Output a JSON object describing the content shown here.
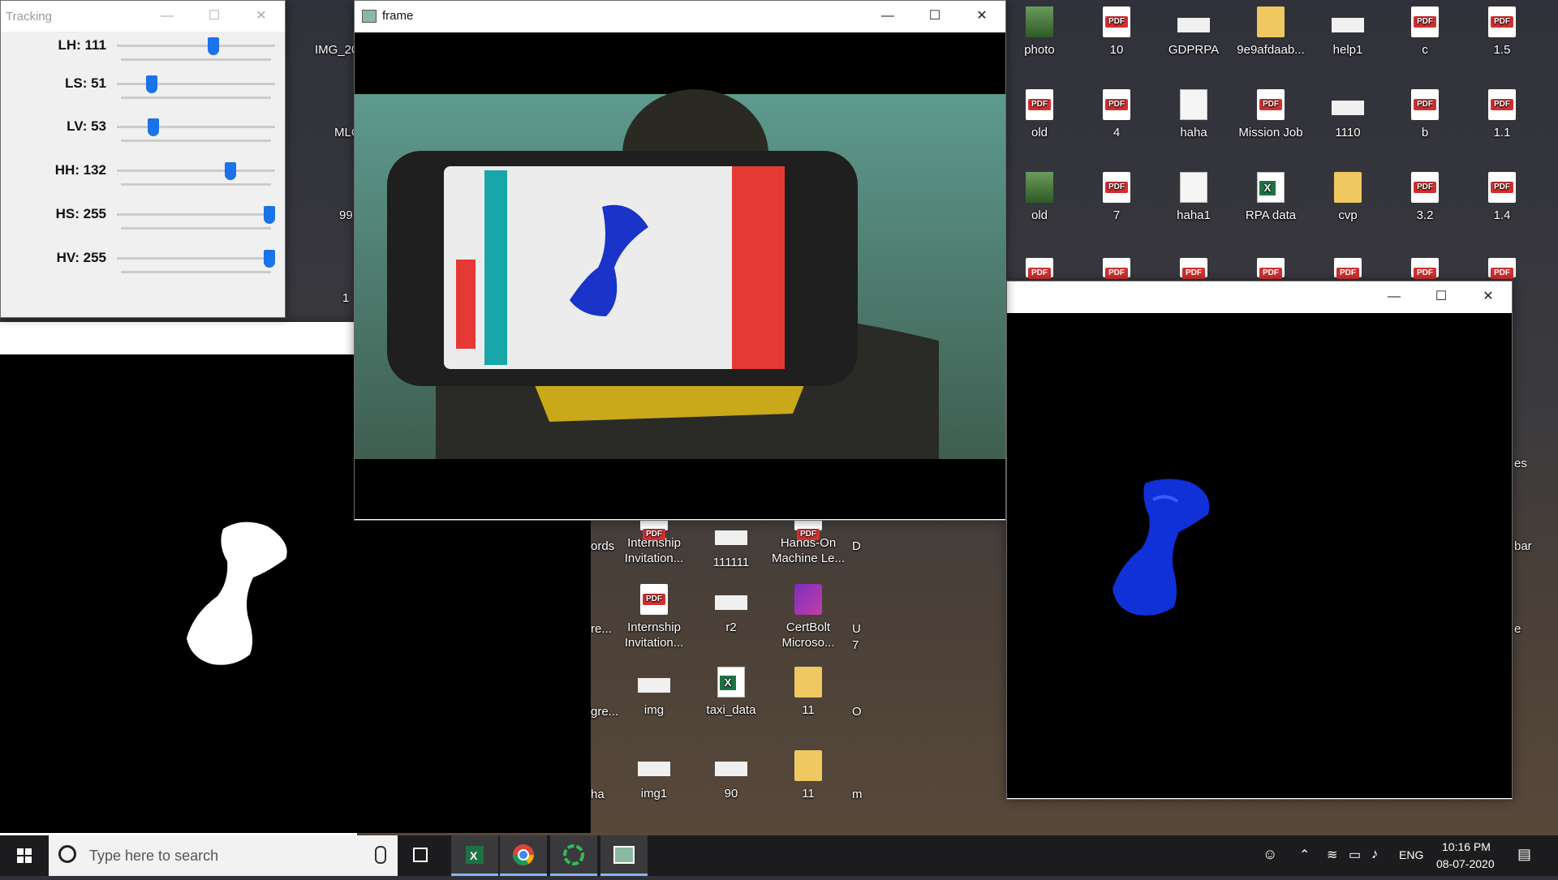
{
  "desktop": {
    "icons_right": [
      {
        "label": "photo",
        "type": "photo"
      },
      {
        "label": "10",
        "type": "pdf"
      },
      {
        "label": "GDPRPA",
        "type": "thumb"
      },
      {
        "label": "9e9afdaab...",
        "type": "folder"
      },
      {
        "label": "help1",
        "type": "thumb"
      },
      {
        "label": "c",
        "type": "pdf"
      },
      {
        "label": "1.5",
        "type": "pdf"
      },
      {
        "label": "old",
        "type": "pdf"
      },
      {
        "label": "4",
        "type": "pdf"
      },
      {
        "label": "haha",
        "type": "doc"
      },
      {
        "label": "Mission Job",
        "type": "pdf"
      },
      {
        "label": "1110",
        "type": "thumb"
      },
      {
        "label": "b",
        "type": "pdf"
      },
      {
        "label": "1.1",
        "type": "pdf"
      },
      {
        "label": "old",
        "type": "photo"
      },
      {
        "label": "7",
        "type": "pdf"
      },
      {
        "label": "haha1",
        "type": "doc"
      },
      {
        "label": "RPA data",
        "type": "xls"
      },
      {
        "label": "cvp",
        "type": "folder"
      },
      {
        "label": "3.2",
        "type": "pdf"
      },
      {
        "label": "1.4",
        "type": "pdf"
      }
    ],
    "icons_middle": [
      {
        "label": "Internship Invitation...",
        "type": "pdf"
      },
      {
        "label": "111111",
        "type": "thumb"
      },
      {
        "label": "Hands-On Machine Le...",
        "type": "pdf"
      },
      {
        "label": "Internship Invitation...",
        "type": "pdf"
      },
      {
        "label": "r2",
        "type": "thumb"
      },
      {
        "label": "CertBolt Microso...",
        "type": "app"
      },
      {
        "label": "img",
        "type": "thumb"
      },
      {
        "label": "taxi_data",
        "type": "xls"
      },
      {
        "label": "11",
        "type": "folder"
      },
      {
        "label": "img1",
        "type": "thumb"
      },
      {
        "label": "90",
        "type": "thumb"
      },
      {
        "label": "11",
        "type": "folder"
      }
    ],
    "partial_left": [
      "IMG_20",
      "MLC",
      "99",
      "1"
    ],
    "partial_mid_left": [
      "ords",
      "re...",
      "gre...",
      "ha"
    ],
    "partial_mid_right": [
      "D",
      "U",
      "7",
      "O",
      "m"
    ],
    "partial_far_right": [
      "es",
      "bar",
      "e"
    ]
  },
  "tracking": {
    "title": "Tracking",
    "sliders": [
      {
        "label": "LH: 111",
        "value": 111,
        "max": 179
      },
      {
        "label": "LS: 51",
        "value": 51,
        "max": 255
      },
      {
        "label": "LV: 53",
        "value": 53,
        "max": 255
      },
      {
        "label": "HH: 132",
        "value": 132,
        "max": 179
      },
      {
        "label": "HS: 255",
        "value": 255,
        "max": 255
      },
      {
        "label": "HV: 255",
        "value": 255,
        "max": 255
      }
    ]
  },
  "frame_window": {
    "title": "frame"
  },
  "taskbar": {
    "search_placeholder": "Type here to search",
    "language": "ENG",
    "time": "10:16 PM",
    "date": "08-07-2020",
    "icons": [
      "windows-start-icon",
      "cortana-icon",
      "microphone-icon",
      "task-view-icon",
      "excel-icon",
      "chrome-icon",
      "spinner-app-icon",
      "python-window-icon"
    ]
  },
  "colors": {
    "accent": "#1a73e8",
    "mask_blue": "#1030d8"
  }
}
